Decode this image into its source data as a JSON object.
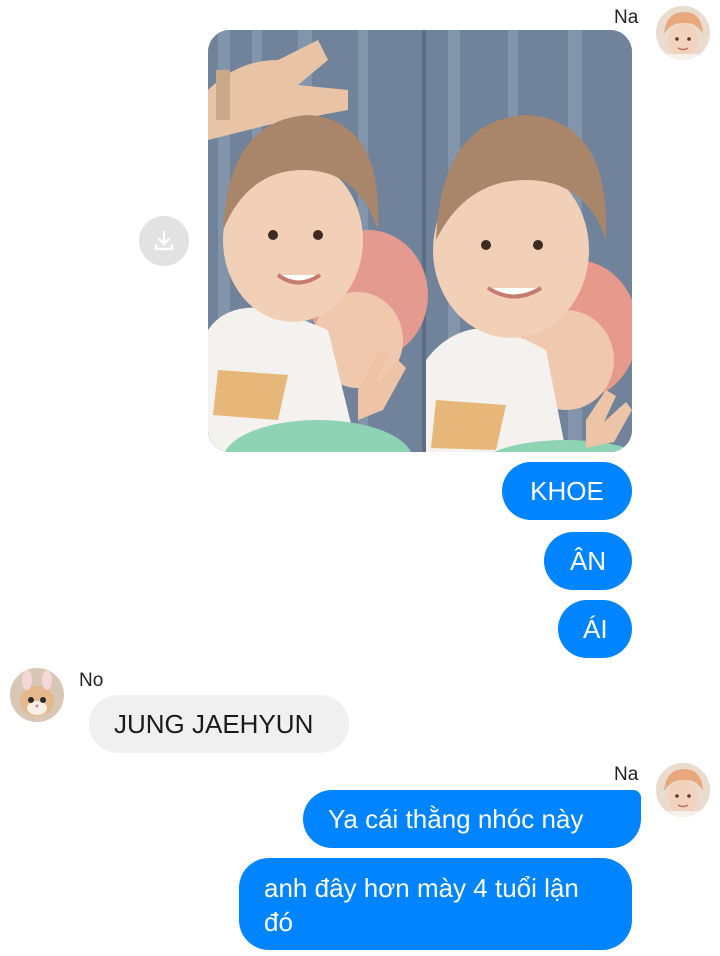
{
  "conversation": {
    "participants": {
      "sender_name": "Na",
      "receiver_name": "No"
    },
    "messages": [
      {
        "from": "Na",
        "type": "image",
        "description_icon": "photo-attachment"
      },
      {
        "from": "Na",
        "type": "text",
        "text": "KHOE"
      },
      {
        "from": "Na",
        "type": "text",
        "text": "ÂN"
      },
      {
        "from": "Na",
        "type": "text",
        "text": "ÁI"
      },
      {
        "from": "No",
        "type": "text",
        "text": "JUNG JAEHYUN"
      },
      {
        "from": "Na",
        "type": "text",
        "text": "Ya cái thằng nhóc này"
      },
      {
        "from": "Na",
        "type": "text",
        "text": "anh đây hơn mày 4 tuổi lận đó"
      }
    ]
  },
  "icons": {
    "download": "download-icon"
  },
  "colors": {
    "outgoing_bubble": "#0084ff",
    "incoming_bubble": "#f0f0f0",
    "background": "#ffffff"
  }
}
